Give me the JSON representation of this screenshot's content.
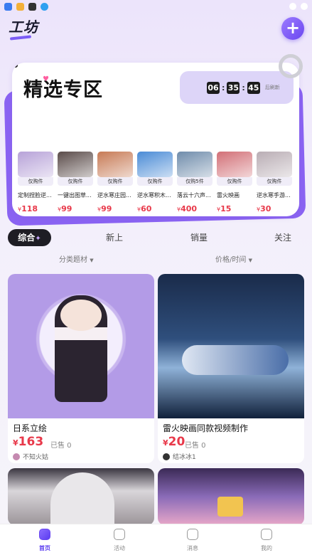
{
  "header": {
    "brand": "工坊",
    "add_label": "+"
  },
  "featured": {
    "title": "精选专区",
    "timer": {
      "h": "06",
      "m": "35",
      "s": "45",
      "suffix": "后刷新"
    },
    "products": [
      {
        "tag": "仅购件",
        "name": "定制捏脸逆...",
        "price": "118",
        "color": "#b7a2d8"
      },
      {
        "tag": "仅购件",
        "name": "一键出图草...",
        "price": "99",
        "color": "#5a4b49"
      },
      {
        "tag": "仅购件",
        "name": "逆水寒庄园...",
        "price": "99",
        "color": "#c77a55"
      },
      {
        "tag": "仅购件",
        "name": "逆水寒积木...",
        "price": "60",
        "color": "#4a8bd6"
      },
      {
        "tag": "仅购5件",
        "name": "落云十六声...",
        "price": "400",
        "color": "#6f8cab"
      },
      {
        "tag": "仅购件",
        "name": "雷火映画",
        "price": "15",
        "color": "#d26f76"
      },
      {
        "tag": "仅购件",
        "name": "逆水寒手游...",
        "price": "30",
        "color": "#b9adb4"
      }
    ],
    "currency": "¥"
  },
  "tabs": [
    {
      "label": "综合"
    },
    {
      "label": "新上"
    },
    {
      "label": "销量"
    },
    {
      "label": "关注"
    }
  ],
  "filters": {
    "category": "分类题材",
    "price_time": "价格/时间"
  },
  "cards": [
    {
      "title": "日系立绘",
      "currency": "¥",
      "price": "163",
      "sold": "已售 0",
      "user": "不知火姑",
      "avatar_color": "#c58ab0"
    },
    {
      "title": "雷火映画同款视频制作",
      "currency": "¥",
      "price": "20",
      "sold": "已售 0",
      "user": "结冰冰1",
      "avatar_color": "#333333"
    }
  ],
  "bottom_nav": [
    {
      "label": "首页",
      "active": true
    },
    {
      "label": "活动",
      "active": false
    },
    {
      "label": "消息",
      "active": false
    },
    {
      "label": "我的",
      "active": false
    }
  ],
  "colors": {
    "accent": "#6a47f0",
    "price": "#e8394a"
  }
}
